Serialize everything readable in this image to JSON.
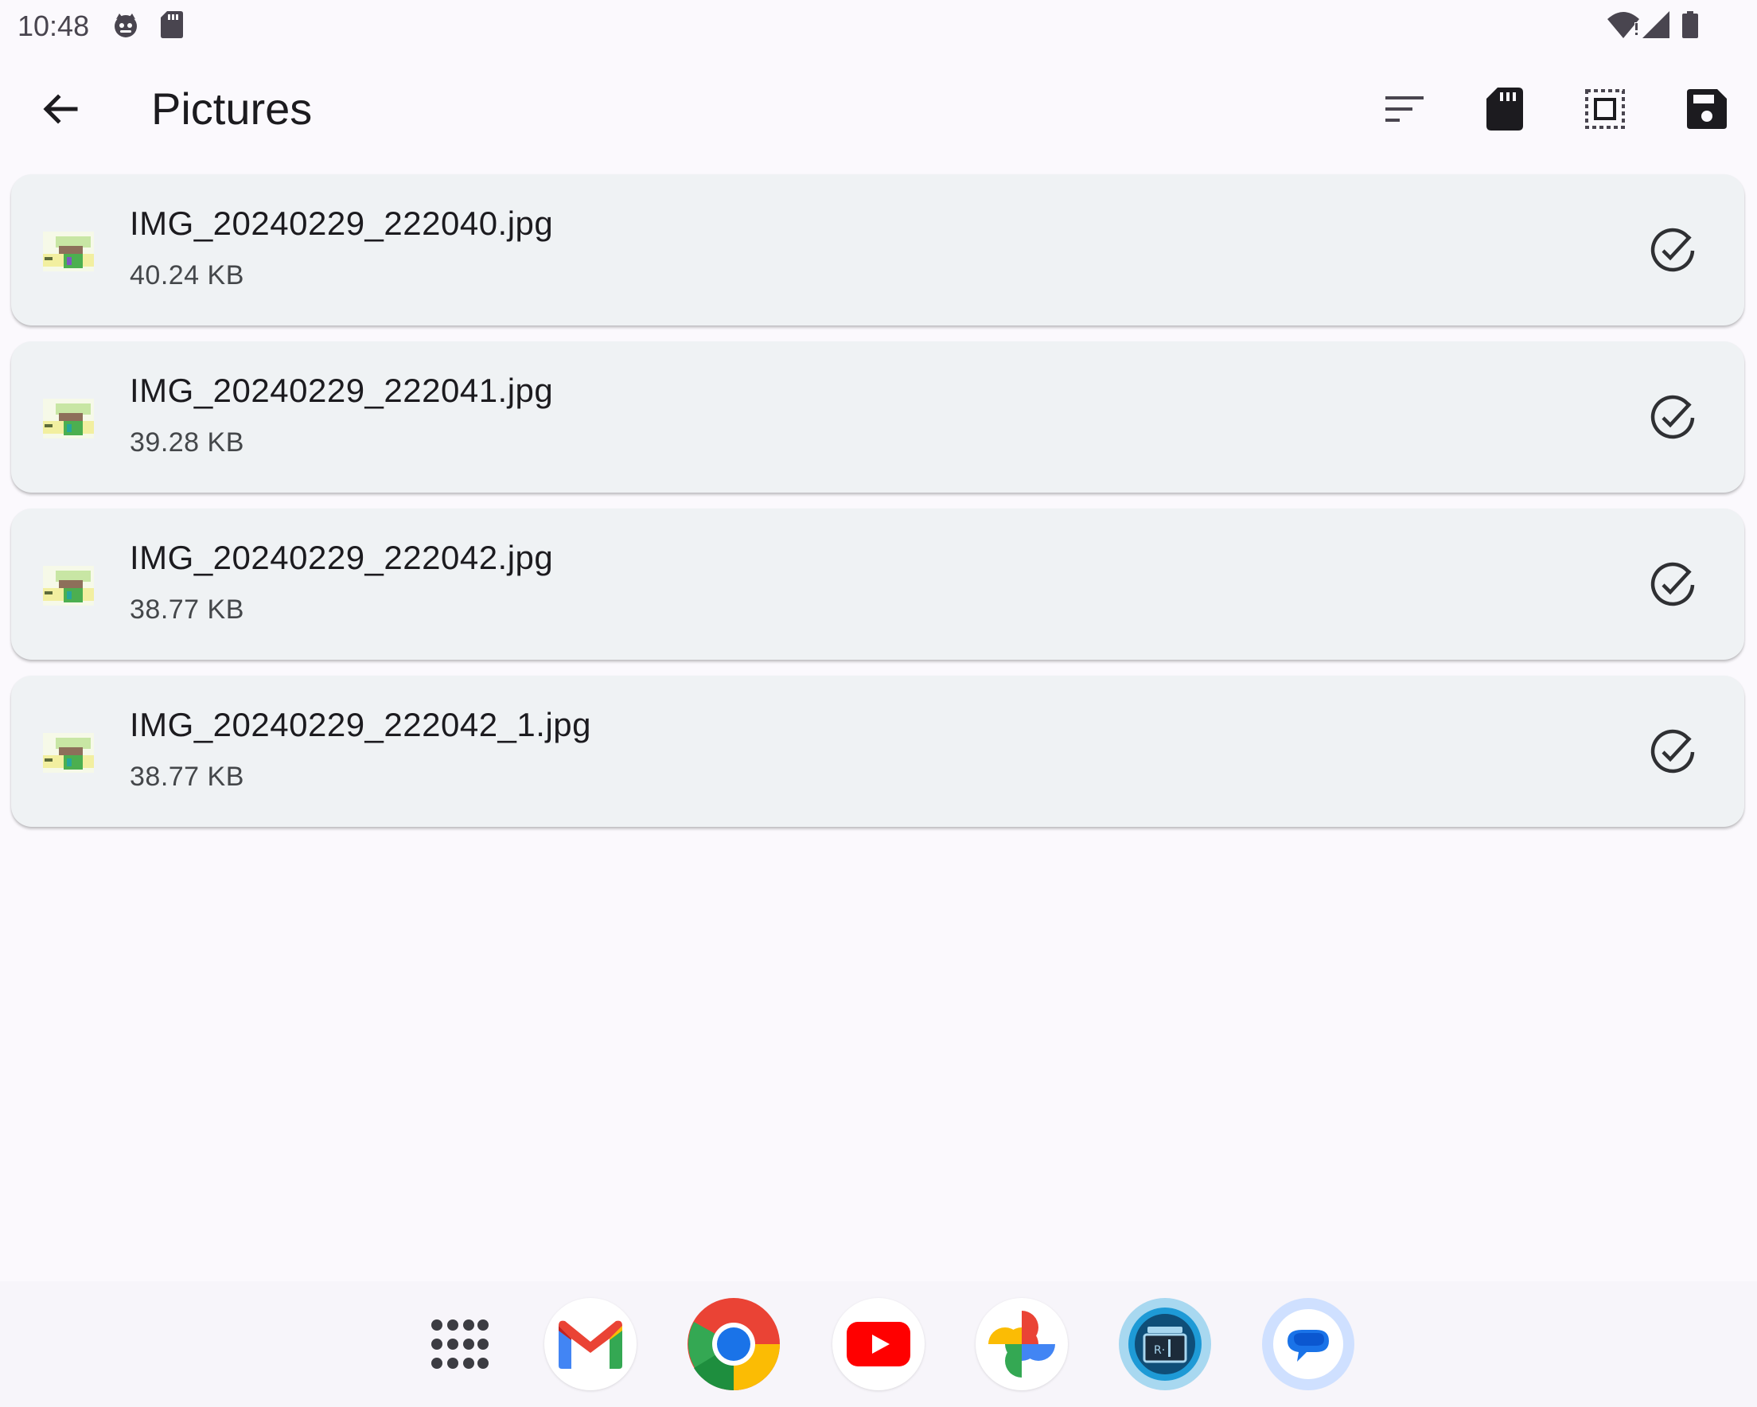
{
  "status_bar": {
    "time": "10:48",
    "icons": [
      "cat-notification-icon",
      "sd-card-icon",
      "wifi-alert-icon",
      "cellular-signal-icon",
      "battery-icon"
    ]
  },
  "app_bar": {
    "title": "Pictures",
    "actions": [
      "sort-icon",
      "sd-card-icon",
      "select-all-icon",
      "save-icon"
    ]
  },
  "files": [
    {
      "name": "IMG_20240229_222040.jpg",
      "size": "40.24 KB",
      "selected": true
    },
    {
      "name": "IMG_20240229_222041.jpg",
      "size": "39.28 KB",
      "selected": true
    },
    {
      "name": "IMG_20240229_222042.jpg",
      "size": "38.77 KB",
      "selected": true
    },
    {
      "name": "IMG_20240229_222042_1.jpg",
      "size": "38.77 KB",
      "selected": true
    }
  ],
  "dock": {
    "apps": [
      "app-drawer",
      "gmail",
      "chrome",
      "youtube",
      "google-photos",
      "file-manager",
      "messages"
    ]
  },
  "colors": {
    "background": "#fbf9fd",
    "card": "#eff2f4",
    "text": "#1c1b1f",
    "secondary_text": "#44474a"
  }
}
